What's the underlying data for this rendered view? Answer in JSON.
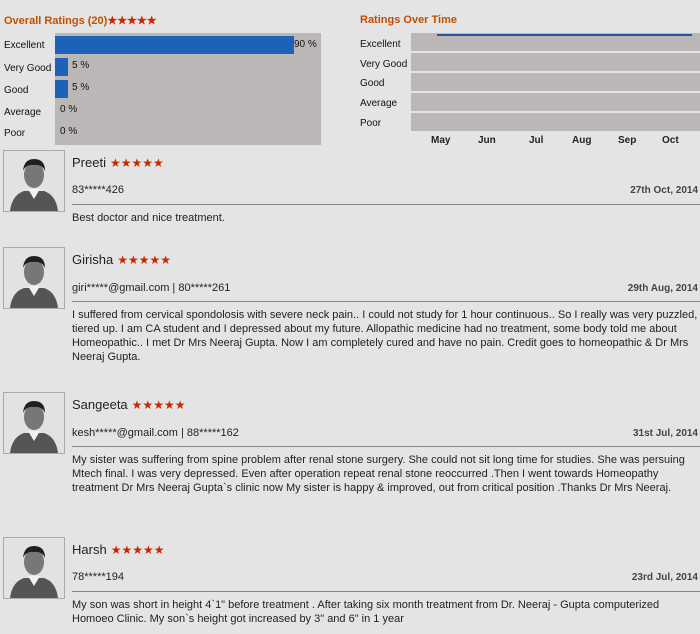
{
  "overall": {
    "title": "Overall Ratings (20)",
    "stars": "★★★★★",
    "rows": [
      {
        "label": "Excellent",
        "pct_text": "90 %",
        "value": 90
      },
      {
        "label": "Very Good",
        "pct_text": "5 %",
        "value": 5
      },
      {
        "label": "Good",
        "pct_text": "5 %",
        "value": 5
      },
      {
        "label": "Average",
        "pct_text": "0 %",
        "value": 0
      },
      {
        "label": "Poor",
        "pct_text": "0 %",
        "value": 0
      }
    ]
  },
  "timeline": {
    "title": "Ratings Over Time",
    "rows": [
      "Excellent",
      "Very Good",
      "Good",
      "Average",
      "Poor"
    ],
    "months": [
      "May",
      "Jun",
      "Jul",
      "Aug",
      "Sep",
      "Oct"
    ]
  },
  "reviews": [
    {
      "name": "Preeti",
      "stars": "★★★★★",
      "contact": "83*****426",
      "date": "27th Oct, 2014",
      "text": "Best doctor and nice treatment."
    },
    {
      "name": "Girisha",
      "stars": "★★★★★",
      "contact": "giri*****@gmail.com | 80*****261",
      "date": "29th Aug, 2014",
      "text": "I suffered from cervical spondolosis with severe neck pain.. I could not study for 1 hour continuous.. So I really was very puzzled, tiered up. I am CA student and I depressed about my future. Allopathic medicine had no treatment, some body told me about Homeopathic.. I met Dr Mrs Neeraj Gupta. Now I am completely cured and have no pain. Credit goes to homeopathic & Dr Mrs Neeraj Gupta."
    },
    {
      "name": "Sangeeta",
      "stars": "★★★★★",
      "contact": "kesh*****@gmail.com | 88*****162",
      "date": "31st Jul, 2014",
      "text": "My sister was suffering from spine problem after renal stone surgery. She could not sit long time for studies. She was persuing Mtech final. I was very depressed. Even after operation repeat renal stone reoccurred .Then I went towards Homeopathy treatment Dr Mrs Neeraj Gupta`s clinic now My sister is happy & improved, out from critical position .Thanks Dr Mrs Neeraj."
    },
    {
      "name": "Harsh",
      "stars": "★★★★★",
      "contact": "78*****194",
      "date": "23rd Jul, 2014",
      "text": "My son was short in height 4`1\" before treatment . After taking six month treatment from Dr. Neeraj - Gupta computerized Homoeo Clinic. My son`s height got increased by 3\" and 6\" in 1 year"
    }
  ]
}
